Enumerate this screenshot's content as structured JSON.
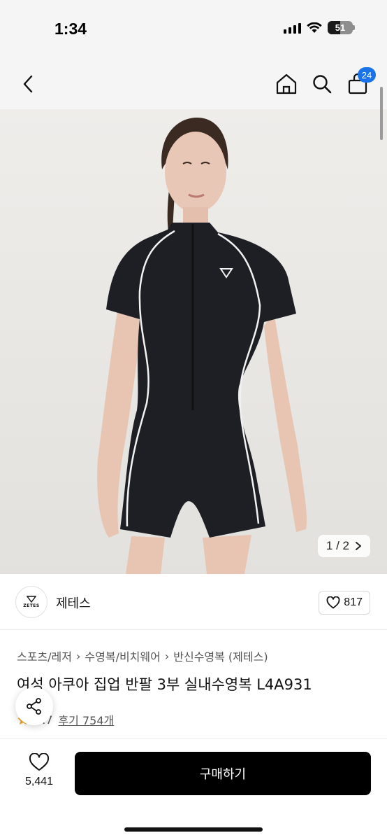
{
  "status_bar": {
    "time": "1:34",
    "battery_level": "51"
  },
  "nav": {
    "cart_badge": "24"
  },
  "gallery": {
    "page_indicator": "1 / 2"
  },
  "seller": {
    "logo_text": "ZETES",
    "name": "제테스",
    "like_count": "817"
  },
  "breadcrumb": [
    "스포츠/레저",
    "수영복/비치웨어",
    "반신수영복 (제테스)"
  ],
  "product": {
    "title": "여성 아쿠아 집업 반팔 3부 실내수영복 L4A931",
    "rating": "4.7",
    "review_text": "후기 754개"
  },
  "bottom_bar": {
    "wish_count": "5,441",
    "buy_label": "구매하기"
  },
  "colors": {
    "accent_badge": "#1a73e8",
    "buy_button": "#000000",
    "star": "#f5a623"
  },
  "icons": [
    "back-icon",
    "home-icon",
    "search-icon",
    "bag-icon",
    "chevron-right-icon",
    "heart-icon",
    "share-icon",
    "star-icon"
  ]
}
